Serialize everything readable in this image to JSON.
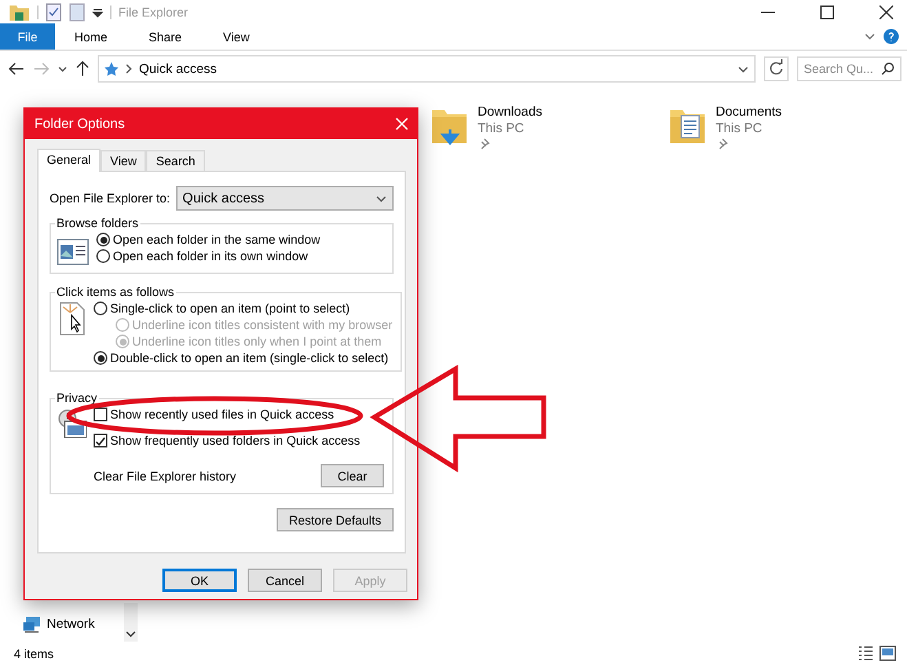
{
  "window": {
    "title": "File Explorer"
  },
  "ribbon": {
    "file_label": "File",
    "tabs": [
      {
        "label": "Home",
        "selected": false
      },
      {
        "label": "Share",
        "selected": false
      },
      {
        "label": "View",
        "selected": false
      }
    ]
  },
  "address": {
    "path": "Quick access",
    "search_placeholder": "Search Qu..."
  },
  "folders": [
    {
      "name": "Downloads",
      "location": "This PC",
      "kind": "downloads"
    },
    {
      "name": "Documents",
      "location": "This PC",
      "kind": "documents"
    }
  ],
  "nav": [
    {
      "label": "Network"
    }
  ],
  "status_bar": {
    "count": "4 items"
  },
  "dialog": {
    "title": "Folder Options",
    "tabs": [
      {
        "label": "General",
        "selected": true
      },
      {
        "label": "View",
        "selected": false
      },
      {
        "label": "Search",
        "selected": false
      }
    ],
    "open_to": {
      "label": "Open File Explorer to:",
      "value": "Quick access"
    },
    "browse": {
      "title": "Browse folders",
      "options": [
        {
          "label": "Open each folder in the same window",
          "checked": true,
          "disabled": false,
          "indent": false
        },
        {
          "label": "Open each folder in its own window",
          "checked": false,
          "disabled": false,
          "indent": false
        }
      ]
    },
    "click": {
      "title": "Click items as follows",
      "options": [
        {
          "label": "Single-click to open an item (point to select)",
          "checked": false,
          "disabled": false,
          "indent": false
        },
        {
          "label": "Underline icon titles consistent with my browser",
          "checked": false,
          "disabled": true,
          "indent": true
        },
        {
          "label": "Underline icon titles only when I point at them",
          "checked": true,
          "disabled": true,
          "indent": true
        },
        {
          "label": "Double-click to open an item (single-click to select)",
          "checked": true,
          "disabled": false,
          "indent": false
        }
      ]
    },
    "privacy": {
      "title": "Privacy",
      "checkboxes": [
        {
          "label": "Show recently used files in Quick access",
          "checked": false,
          "highlighted": true
        },
        {
          "label": "Show frequently used folders in Quick access",
          "checked": true,
          "highlighted": false
        }
      ],
      "clear_label": "Clear File Explorer history",
      "clear_button": "Clear"
    },
    "restore_button": "Restore Defaults",
    "buttons": [
      {
        "label": "OK",
        "default": true,
        "disabled": false
      },
      {
        "label": "Cancel",
        "default": false,
        "disabled": false
      },
      {
        "label": "Apply",
        "default": false,
        "disabled": true
      }
    ]
  }
}
